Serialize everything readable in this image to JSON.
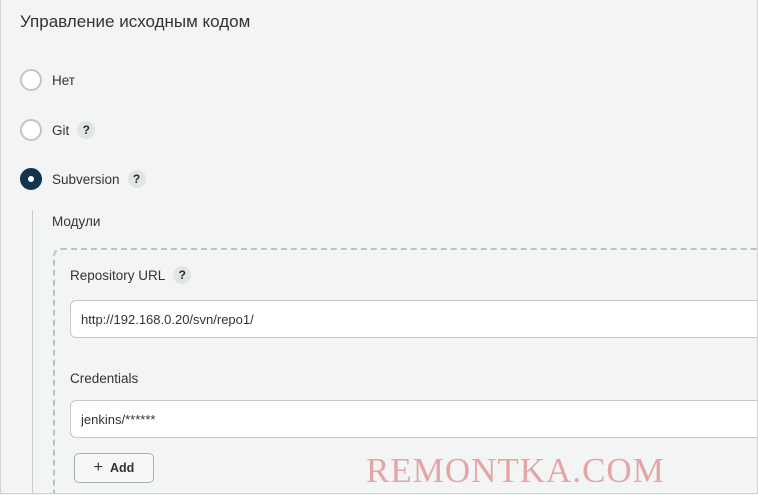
{
  "section": {
    "title": "Управление исходным кодом"
  },
  "scm_options": [
    {
      "label": "Нет",
      "selected": false,
      "has_help": false
    },
    {
      "label": "Git",
      "selected": false,
      "has_help": true
    },
    {
      "label": "Subversion",
      "selected": true,
      "has_help": true
    }
  ],
  "help_glyph": "?",
  "modules": {
    "label": "Модули",
    "repository_url": {
      "label": "Repository URL",
      "value": "http://192.168.0.20/svn/repo1/"
    },
    "credentials": {
      "label": "Credentials",
      "value": "jenkins/******"
    },
    "add_button": {
      "icon": "plus-icon",
      "label": "Add"
    }
  },
  "watermark": "REMONTKA.COM",
  "colors": {
    "background": "#f3f4f4",
    "radio_selected": "#12344d",
    "radio_unselected_border": "#c2c6c9",
    "dashed_border": "#b9c3ca",
    "watermark": "#e29696"
  }
}
